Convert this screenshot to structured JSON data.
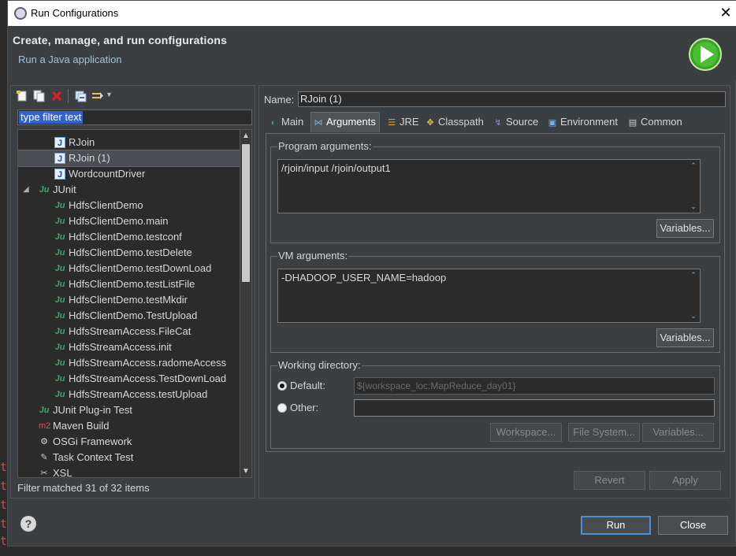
{
  "window": {
    "title": "Run Configurations"
  },
  "header": {
    "title": "Create, manage, and run configurations",
    "subtitle": "Run a Java application"
  },
  "left": {
    "filter_text": "type filter text",
    "status": "Filter matched 31 of 32 items",
    "tree": [
      {
        "label": "RJoin",
        "icon": "java-app-icon",
        "indent": 2
      },
      {
        "label": "RJoin (1)",
        "icon": "java-app-icon",
        "indent": 2,
        "selected": true
      },
      {
        "label": "WordcountDriver",
        "icon": "java-app-icon",
        "indent": 2
      },
      {
        "label": "JUnit",
        "icon": "junit-icon",
        "indent": 1,
        "expanded": true
      },
      {
        "label": "HdfsClientDemo",
        "icon": "junit-icon",
        "indent": 2
      },
      {
        "label": "HdfsClientDemo.main",
        "icon": "junit-icon",
        "indent": 2
      },
      {
        "label": "HdfsClientDemo.testconf",
        "icon": "junit-icon",
        "indent": 2
      },
      {
        "label": "HdfsClientDemo.testDelete",
        "icon": "junit-icon",
        "indent": 2
      },
      {
        "label": "HdfsClientDemo.testDownLoad",
        "icon": "junit-icon",
        "indent": 2
      },
      {
        "label": "HdfsClientDemo.testListFile",
        "icon": "junit-icon",
        "indent": 2
      },
      {
        "label": "HdfsClientDemo.testMkdir",
        "icon": "junit-icon",
        "indent": 2
      },
      {
        "label": "HdfsClientDemo.TestUpload",
        "icon": "junit-icon",
        "indent": 2
      },
      {
        "label": "HdfsStreamAccess.FileCat",
        "icon": "junit-icon",
        "indent": 2
      },
      {
        "label": "HdfsStreamAccess.init",
        "icon": "junit-icon",
        "indent": 2
      },
      {
        "label": "HdfsStreamAccess.radomeAccess",
        "icon": "junit-icon",
        "indent": 2
      },
      {
        "label": "HdfsStreamAccess.TestDownLoad",
        "icon": "junit-icon",
        "indent": 2
      },
      {
        "label": "HdfsStreamAccess.testUpload",
        "icon": "junit-icon",
        "indent": 2
      },
      {
        "label": "JUnit Plug-in Test",
        "icon": "junit-plugin-icon",
        "indent": 1
      },
      {
        "label": "Maven Build",
        "icon": "maven-icon",
        "indent": 1
      },
      {
        "label": "OSGi Framework",
        "icon": "osgi-icon",
        "indent": 1
      },
      {
        "label": "Task Context Test",
        "icon": "task-context-icon",
        "indent": 1
      },
      {
        "label": "XSL",
        "icon": "xsl-icon",
        "indent": 1
      }
    ]
  },
  "right": {
    "name_label": "Name:",
    "name_value": "RJoin (1)",
    "tabs": [
      {
        "label": "Main",
        "icon": "main-tab-icon"
      },
      {
        "label": "Arguments",
        "icon": "arguments-tab-icon",
        "active": true
      },
      {
        "label": "JRE",
        "icon": "jre-tab-icon"
      },
      {
        "label": "Classpath",
        "icon": "classpath-tab-icon"
      },
      {
        "label": "Source",
        "icon": "source-tab-icon"
      },
      {
        "label": "Environment",
        "icon": "environment-tab-icon"
      },
      {
        "label": "Common",
        "icon": "common-tab-icon"
      }
    ],
    "program_args": {
      "label": "Program arguments:",
      "value": "/rjoin/input  /rjoin/output1",
      "variables_btn": "Variables..."
    },
    "vm_args": {
      "label": "VM arguments:",
      "value": "-DHADOOP_USER_NAME=hadoop",
      "variables_btn": "Variables..."
    },
    "working_dir": {
      "label": "Working directory:",
      "default_label": "Default:",
      "default_value": "${workspace_loc:MapReduce_day01}",
      "other_label": "Other:",
      "other_value": "",
      "workspace_btn": "Workspace...",
      "filesystem_btn": "File System...",
      "variables_btn": "Variables..."
    },
    "revert_btn": "Revert",
    "apply_btn": "Apply"
  },
  "footer": {
    "help_icon": "?",
    "run_btn": "Run",
    "close_btn": "Close"
  },
  "colors": {
    "dialog_bg": "#3c3f41",
    "selection": "#2f65ca",
    "accent_border": "#4a90d9",
    "run_icon": "#3aa02a"
  }
}
